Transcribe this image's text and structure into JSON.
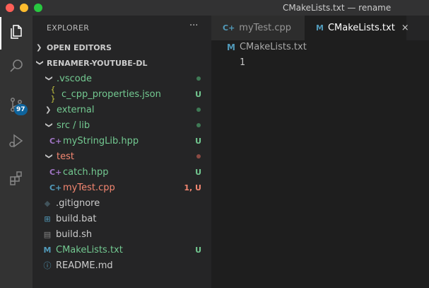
{
  "window": {
    "title": "CMakeLists.txt — rename"
  },
  "activity_bar": {
    "items": [
      {
        "name": "explorer",
        "icon": "files-icon",
        "active": true
      },
      {
        "name": "search",
        "icon": "search-icon"
      },
      {
        "name": "source-control",
        "icon": "source-control-icon",
        "badge": "97"
      },
      {
        "name": "run-debug",
        "icon": "debug-icon"
      },
      {
        "name": "extensions",
        "icon": "extensions-icon"
      }
    ]
  },
  "sidebar": {
    "header": "EXPLORER",
    "more_label": "···",
    "sections": {
      "open_editors": "OPEN EDITORS",
      "project": "RENAMER-YOUTUBE-DL"
    },
    "tree": [
      {
        "label": ".vscode",
        "type": "folder",
        "expanded": true,
        "status": "",
        "dot": "green",
        "color": "#73c991"
      },
      {
        "label": "c_cpp_properties.json",
        "type": "json",
        "status": "U",
        "color": "#73c991"
      },
      {
        "label": "external",
        "type": "folder",
        "expanded": false,
        "status": "",
        "dot": "green",
        "color": "#73c991"
      },
      {
        "label": "src / lib",
        "type": "folder",
        "expanded": true,
        "status": "",
        "dot": "green",
        "color": "#73c991"
      },
      {
        "label": "myStringLib.hpp",
        "type": "cpp",
        "status": "U",
        "color": "#73c991"
      },
      {
        "label": "test",
        "type": "folder",
        "expanded": true,
        "status": "",
        "dot": "red",
        "color": "#f48771"
      },
      {
        "label": "catch.hpp",
        "type": "cpp",
        "status": "U",
        "color": "#73c991"
      },
      {
        "label": "myTest.cpp",
        "type": "cpp",
        "status": "1, U",
        "color": "#f48771"
      },
      {
        "label": ".gitignore",
        "type": "git",
        "status": "",
        "color": "#cccccc"
      },
      {
        "label": "build.bat",
        "type": "windows",
        "status": "",
        "color": "#cccccc"
      },
      {
        "label": "build.sh",
        "type": "shell",
        "status": "",
        "color": "#cccccc"
      },
      {
        "label": "CMakeLists.txt",
        "type": "cmake",
        "status": "U",
        "color": "#73c991"
      },
      {
        "label": "README.md",
        "type": "info",
        "status": "",
        "color": "#cccccc"
      }
    ]
  },
  "tabs": [
    {
      "label": "myTest.cpp",
      "icon": "cpp-icon",
      "active": false
    },
    {
      "label": "CMakeLists.txt",
      "icon": "cmake-icon",
      "active": true,
      "close": "×"
    }
  ],
  "breadcrumb": {
    "file": "CMakeLists.txt"
  },
  "editor": {
    "line_numbers": [
      "1"
    ]
  },
  "colors": {
    "untracked": "#73c991",
    "error": "#f48771",
    "accent": "#0e639c"
  }
}
